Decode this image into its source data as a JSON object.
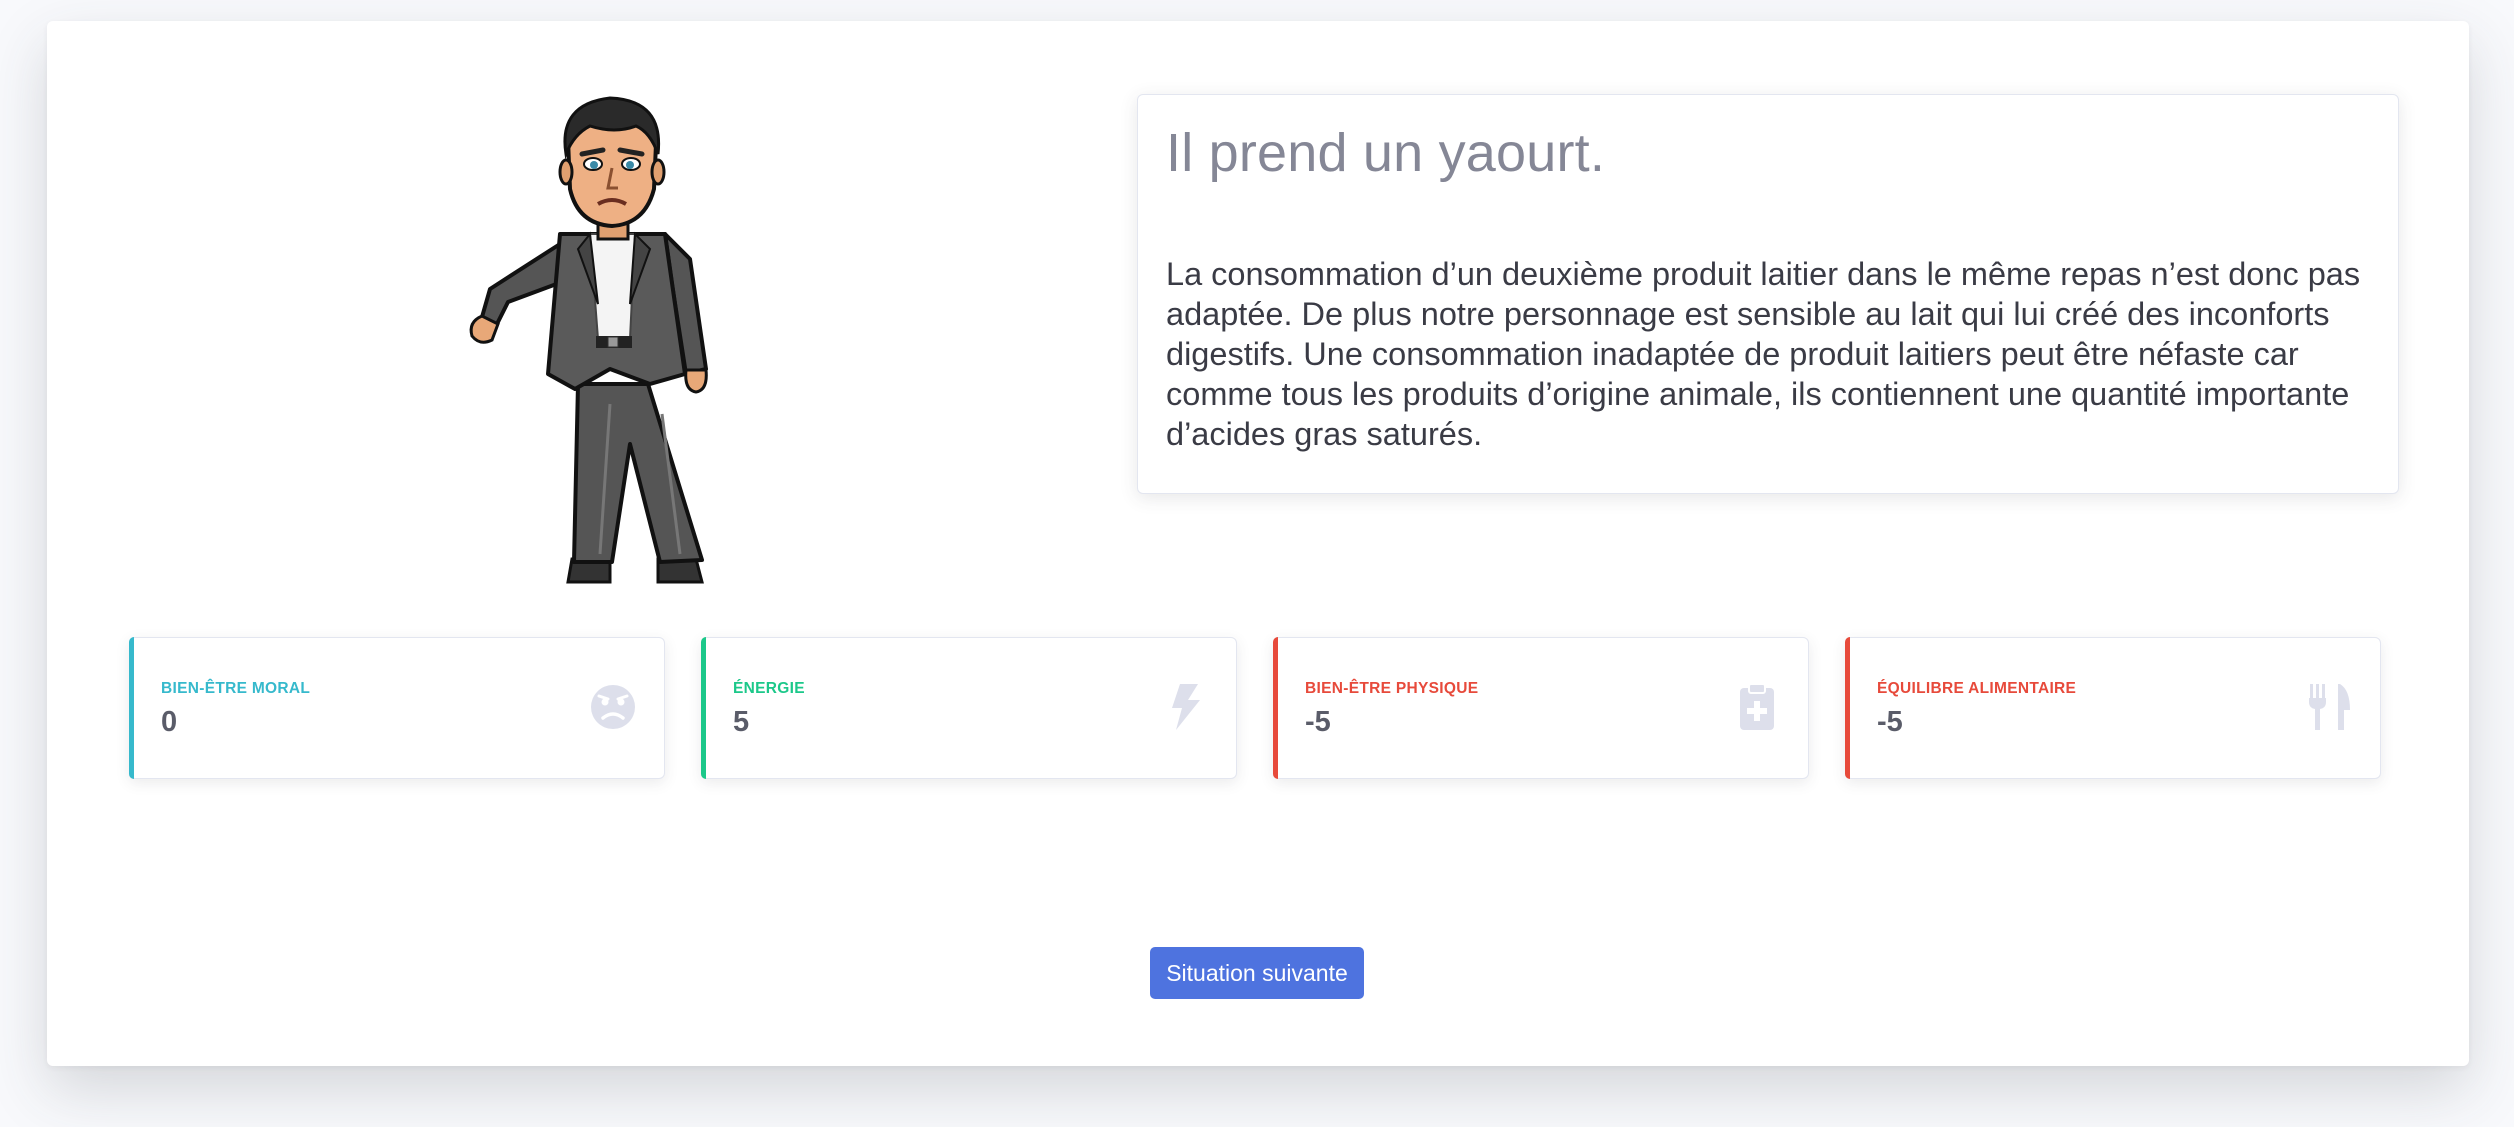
{
  "scene": {
    "title": "Il prend un yaourt.",
    "description": "La consommation d’un deuxième produit laitier dans le même repas n’est donc pas adaptée. De plus notre personnage est sensible au lait qui lui créé des inconforts digestifs. Une consommation inadaptée de produit laitiers peut être néfaste car comme tous les produits d’origine animale, ils contiennent une quantité importante d’acides gras saturés."
  },
  "stats": [
    {
      "label": "Bien-être moral",
      "value": "0",
      "accent": "#36b9cc",
      "icon": "sad-face-icon"
    },
    {
      "label": "Énergie",
      "value": "5",
      "accent": "#1cc88a",
      "icon": "lightning-bolt-icon"
    },
    {
      "label": "Bien-être physique",
      "value": "-5",
      "accent": "#e74a3b",
      "icon": "medical-clipboard-icon"
    },
    {
      "label": "Équilibre alimentaire",
      "value": "-5",
      "accent": "#e74a3b",
      "icon": "fork-knife-icon"
    }
  ],
  "actions": {
    "next_label": "Situation suivante"
  },
  "colors": {
    "primary": "#4e73df",
    "icon_gray": "#dddfeb",
    "text_muted": "#858796",
    "text_body": "#3a3b45"
  }
}
